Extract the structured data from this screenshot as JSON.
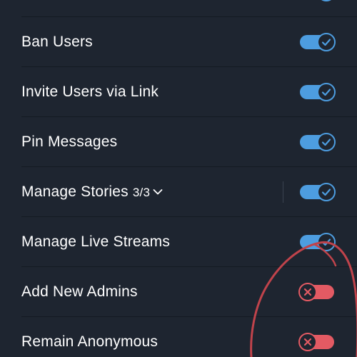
{
  "permissions": [
    {
      "label": "Ban Users",
      "enabled": true
    },
    {
      "label": "Invite Users via Link",
      "enabled": true
    },
    {
      "label": "Pin Messages",
      "enabled": true
    },
    {
      "label": "Manage Stories",
      "count": "3/3",
      "enabled": true,
      "expandable": true
    },
    {
      "label": "Manage Live Streams",
      "enabled": true
    },
    {
      "label": "Add New Admins",
      "enabled": false
    },
    {
      "label": "Remain Anonymous",
      "enabled": false
    }
  ],
  "colors": {
    "background": "#1e2530",
    "toggle_on": "#4d9de0",
    "toggle_off": "#e35a63",
    "annotation": "#c0434b"
  },
  "icons": {
    "on": "check-icon",
    "off": "close-icon",
    "expand": "chevron-down-icon"
  }
}
